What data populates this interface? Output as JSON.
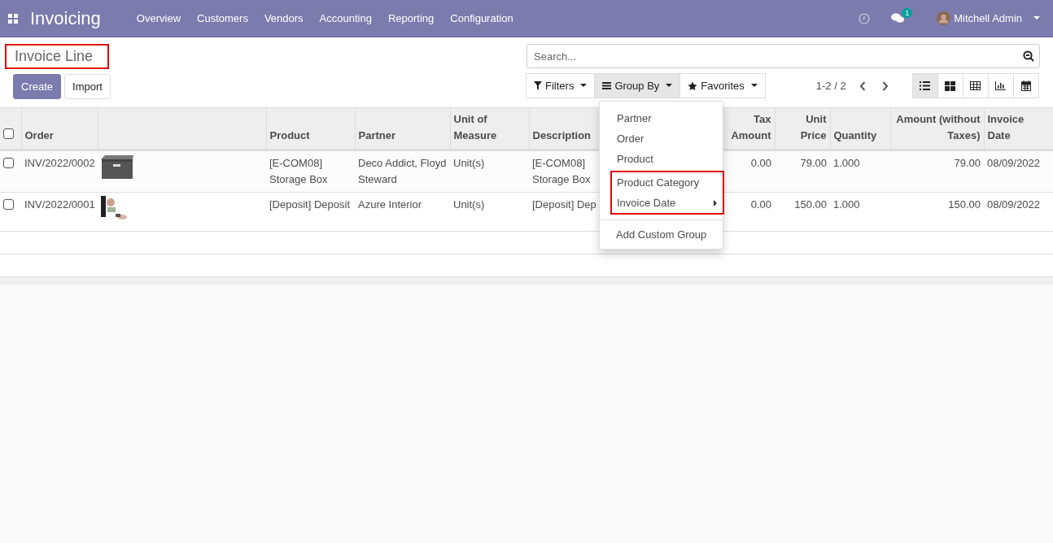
{
  "navbar": {
    "app_name": "Invoicing",
    "menu": [
      "Overview",
      "Customers",
      "Vendors",
      "Accounting",
      "Reporting",
      "Configuration"
    ],
    "message_count": "1",
    "user": "Mitchell Admin"
  },
  "title": {
    "text": "Invoice Line",
    "highlighted": true
  },
  "buttons": {
    "create": "Create",
    "import": "Import"
  },
  "search": {
    "placeholder": "Search..."
  },
  "search_buttons": [
    {
      "kind": "filter",
      "label": "Filters",
      "selected": false
    },
    {
      "kind": "group",
      "label": "Group By",
      "selected": true
    },
    {
      "kind": "star",
      "label": "Favorites",
      "selected": false
    }
  ],
  "pager": "1-2 / 2",
  "views": [
    {
      "kind": "list",
      "selected": true
    },
    {
      "kind": "kanban",
      "selected": false
    },
    {
      "kind": "pivot",
      "selected": false
    },
    {
      "kind": "graph",
      "selected": false
    },
    {
      "kind": "calendar",
      "selected": false
    }
  ],
  "table": {
    "select_all_checked": false,
    "columns": [
      {
        "label": "Order"
      },
      {},
      {
        "label": "Product"
      },
      {
        "label": "Partner"
      },
      {
        "label": "Unit of Measure"
      },
      {
        "label": "Description"
      },
      {
        "label": "Tax Amount"
      },
      {
        "label": "Unit Price"
      },
      {
        "label": "Quantity"
      },
      {
        "label": "Amount (without Taxes)"
      },
      {
        "label": "Invoice Date"
      }
    ],
    "rows": [
      {
        "checked": false,
        "cells": [
          "INV/2022/0002",
          {
            "kind": "picture"
          },
          "[E-COM08] Storage Box",
          "Deco Addict, Floyd Steward",
          "Unit(s)",
          "[E-COM08] Storage Box",
          "0.00",
          "79.00",
          "1.000",
          "79.00",
          "08/09/2022"
        ]
      },
      {
        "checked": false,
        "cells": [
          "INV/2022/0001",
          {
            "kind": "picture"
          },
          "[Deposit] Deposit",
          "Azure Interior",
          "Unit(s)",
          "[Deposit] Dep",
          "0.00",
          "150.00",
          "1.000",
          "150.00",
          "08/09/2022"
        ]
      }
    ]
  },
  "groupby_menu": {
    "sections": [
      {
        "highlighted": false,
        "items": [
          {
            "label": "Partner",
            "has_submenu": false
          },
          {
            "label": "Order",
            "has_submenu": false
          },
          {
            "label": "Product",
            "has_submenu": false
          }
        ]
      },
      {
        "highlighted": true,
        "items": [
          {
            "label": "Product Category",
            "has_submenu": false
          },
          {
            "label": "Invoice Date",
            "has_submenu": true
          }
        ]
      }
    ],
    "custom": "Add Custom Group"
  }
}
